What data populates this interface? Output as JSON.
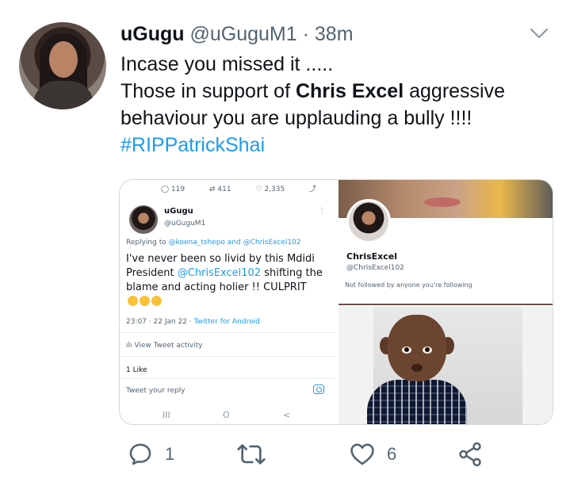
{
  "tweet": {
    "display_name": "uGugu",
    "handle": "@uGuguM1",
    "separator": "·",
    "time": "38m",
    "text_line1": "Incase you missed it .....",
    "text_prefix": "Those in support of ",
    "text_bold": "Chris Excel",
    "text_middle": " aggressive behaviour you are upplauding a bully !!!! ",
    "hashtag": "#RIPPatrickShai"
  },
  "embedded_left": {
    "stats": {
      "replies": "119",
      "retweets": "411",
      "likes": "2,335"
    },
    "name": "uGugu",
    "handle": "@uGuguM1",
    "menu_glyph": "⋮",
    "replying_prefix": "Replying to ",
    "replying_links": "@koena_tshepo and @ChrisExcel102",
    "text_a": "I've never been so livid by this Mdidi President ",
    "mention": "@ChrisExcel102",
    "text_b": " shifting the blame and acting holier !! CULPRIT",
    "meta_date": "23:07 · 22 Jan 22 · ",
    "meta_client": "Twitter for Android",
    "activity_label": "View Tweet activity",
    "likes_label": "1 Like",
    "reply_placeholder": "Tweet your reply",
    "nav": {
      "recent": "III",
      "home": "O",
      "back": "<"
    }
  },
  "embedded_right_profile": {
    "name": "ChrisExcel",
    "handle": "@ChrisExcel102",
    "note": "Not followed by anyone you're following"
  },
  "actions": {
    "reply_count": "1",
    "retweet_count": "",
    "like_count": "6"
  },
  "icons": {
    "chevron": "chevron-down-icon",
    "reply": "reply-icon",
    "retweet": "retweet-icon",
    "like": "heart-icon",
    "share": "share-icon"
  },
  "colors": {
    "accent": "#1d9bf0",
    "text": "#0f1419",
    "muted": "#536471"
  }
}
